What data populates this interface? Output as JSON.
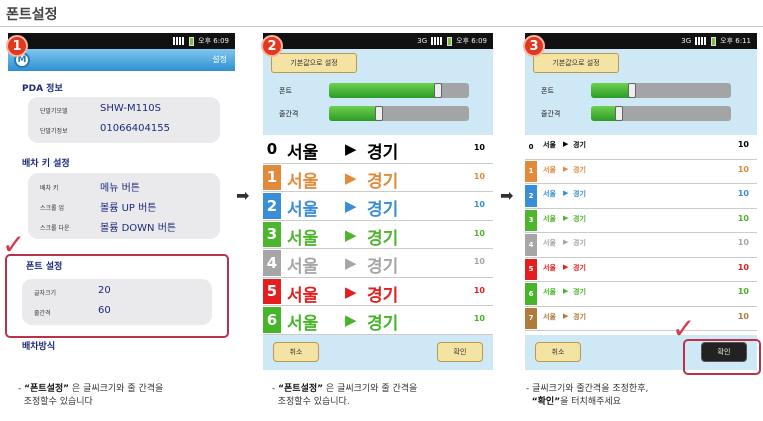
{
  "page_title": "폰트설정",
  "status_time1": "오후 6:09",
  "status_time2": "오후 6:09",
  "status_time3": "오후 6:11",
  "status_net": "3G",
  "step_numbers": [
    "1",
    "2",
    "3"
  ],
  "phone1": {
    "logo": "M",
    "header": "설정",
    "pda_title": "PDA 정보",
    "model_label": "단말기모델",
    "model_value": "SHW-M110S",
    "info_label": "단말기정보",
    "info_value": "01066404155",
    "key_title": "배차 키 설정",
    "key_label": "배차 키",
    "key_value": "메뉴 버튼",
    "scrollup_label": "스크롤 업",
    "scrollup_value": "볼륨 UP 버튼",
    "scrolldown_label": "스크롤 다운",
    "scrolldown_value": "볼륨 DOWN 버튼",
    "font_title": "폰트 설정",
    "fontsize_label": "글자크기",
    "fontsize_value": "20",
    "spacing_label": "줄간격",
    "spacing_value": "60",
    "method_title": "배차방식"
  },
  "phone2": {
    "reset_button": "기본값으로 설정",
    "font_label": "폰트",
    "spacing_label": "줄간격",
    "font_level": 0.78,
    "spacing_level": 0.36,
    "cancel": "취소",
    "confirm": "확인"
  },
  "phone3": {
    "reset_button": "기본값으로 설정",
    "font_label": "폰트",
    "spacing_label": "줄간격",
    "font_level": 0.29,
    "spacing_level": 0.2,
    "cancel": "취소",
    "confirm": "확인"
  },
  "rows": [
    {
      "num": "0",
      "from": "서울",
      "to": "경기",
      "count": "10",
      "color": "#000000"
    },
    {
      "num": "1",
      "from": "서울",
      "to": "경기",
      "count": "10",
      "color": "#e28a3a"
    },
    {
      "num": "2",
      "from": "서울",
      "to": "경기",
      "count": "10",
      "color": "#3a8ed8"
    },
    {
      "num": "3",
      "from": "서울",
      "to": "경기",
      "count": "10",
      "color": "#4eb52e"
    },
    {
      "num": "4",
      "from": "서울",
      "to": "경기",
      "count": "10",
      "color": "#a6a6a6"
    },
    {
      "num": "5",
      "from": "서울",
      "to": "경기",
      "count": "10",
      "color": "#e41e1e"
    },
    {
      "num": "6",
      "from": "서울",
      "to": "경기",
      "count": "10",
      "color": "#46b52a"
    }
  ],
  "rows3_extra": {
    "num": "7",
    "from": "서울",
    "to": "경기",
    "count": "10",
    "color": "#b07a3a"
  },
  "captions": {
    "c1_bold": "“폰트설정”",
    "c1_rest": " 은 글씨크기와 줄 간격을",
    "c1_line2": "조정할수 있습니다",
    "c2_bold": "“폰트설정”",
    "c2_rest": " 은 글씨크기와 줄 간격을",
    "c2_line2": "조정할수 있습니다.",
    "c3_line1": "글씨크기와 줄간격을 조정한후,",
    "c3_bold": "“확인”",
    "c3_rest": "을 터치해주세요"
  }
}
